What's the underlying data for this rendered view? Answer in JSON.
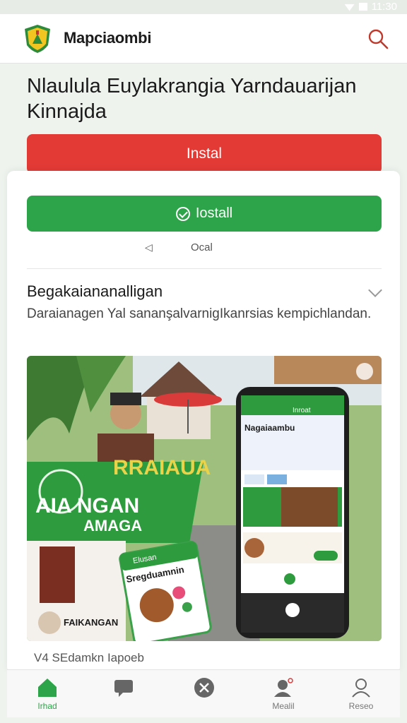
{
  "status": {
    "time": "11:30"
  },
  "header": {
    "app_name": "Mapciaombi",
    "logo_icon": "shield-logo-icon",
    "search_icon": "search-icon"
  },
  "page": {
    "title": "Nlaulula Euylakrangia Yarndauarijan Kinnajda"
  },
  "buttons": {
    "install_red": "Instal",
    "install_green": "Iostall"
  },
  "meta": {
    "icon": "speaker-icon",
    "text": "Ocal"
  },
  "section": {
    "title": "Begakaiananalligan",
    "description": "Daraianagen Yal sananşalvarnigIkanrsias kempichlandan."
  },
  "banner": {
    "headline": "RRAIAUA",
    "tagline_1": "AIA NGAN",
    "tagline_2": "AMAGA",
    "phone_app_name": "Nagaiaambu",
    "phone_topbar": "Inroat",
    "small_card_title": "Sregduamnin",
    "small_card_header": "Elusan",
    "profile_label": "FAIKANGAN"
  },
  "caption": "V4 SEdamkn Iapoeb",
  "nav": [
    {
      "label": "Irhad",
      "icon": "home-icon",
      "active": true
    },
    {
      "label": "",
      "icon": "chat-icon",
      "active": false
    },
    {
      "label": "",
      "icon": "close-circle-icon",
      "active": false
    },
    {
      "label": "Mealil",
      "icon": "account-alert-icon",
      "active": false
    },
    {
      "label": "Reseo",
      "icon": "profile-icon",
      "active": false
    }
  ],
  "colors": {
    "brand_green": "#2ea44a",
    "alert_red": "#e33a36"
  }
}
